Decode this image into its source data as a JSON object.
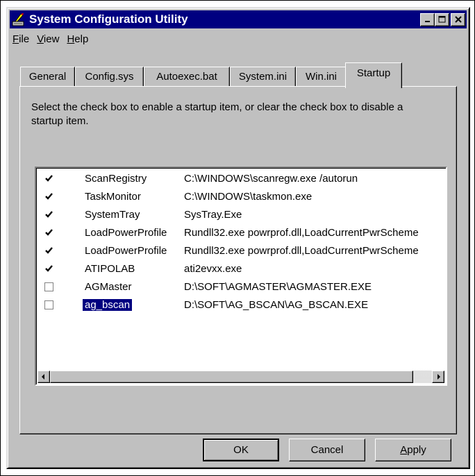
{
  "window": {
    "title": "System Configuration Utility",
    "titlebar_color": "#000080"
  },
  "menu": [
    {
      "label_first": "F",
      "label_rest": "ile"
    },
    {
      "label_first": "V",
      "label_rest": "iew"
    },
    {
      "label_first": "H",
      "label_rest": "elp"
    }
  ],
  "tabs": [
    "General",
    "Config.sys",
    "Autoexec.bat",
    "System.ini",
    "Win.ini",
    "Startup"
  ],
  "active_tab": "Startup",
  "description": "Select the check box to enable a startup item, or clear the check box to disable a startup item.",
  "startup_items": [
    {
      "checked": true,
      "name": "ScanRegistry",
      "command": "C:\\WINDOWS\\scanregw.exe /autorun"
    },
    {
      "checked": true,
      "name": "TaskMonitor",
      "command": "C:\\WINDOWS\\taskmon.exe"
    },
    {
      "checked": true,
      "name": "SystemTray",
      "command": "SysTray.Exe"
    },
    {
      "checked": true,
      "name": "LoadPowerProfile",
      "command": "Rundll32.exe powrprof.dll,LoadCurrentPwrScheme"
    },
    {
      "checked": true,
      "name": "LoadPowerProfile",
      "command": "Rundll32.exe powrprof.dll,LoadCurrentPwrScheme"
    },
    {
      "checked": true,
      "name": "ATIPOLAB",
      "command": "ati2evxx.exe"
    },
    {
      "checked": false,
      "name": "AGMaster",
      "command": "D:\\SOFT\\AGMASTER\\AGMASTER.EXE"
    },
    {
      "checked": false,
      "name": "ag_bscan",
      "command": "D:\\SOFT\\AG_BSCAN\\AG_BSCAN.EXE",
      "selected": true
    }
  ],
  "buttons": {
    "ok": "OK",
    "cancel": "Cancel",
    "apply_first": "A",
    "apply_rest": "pply"
  }
}
